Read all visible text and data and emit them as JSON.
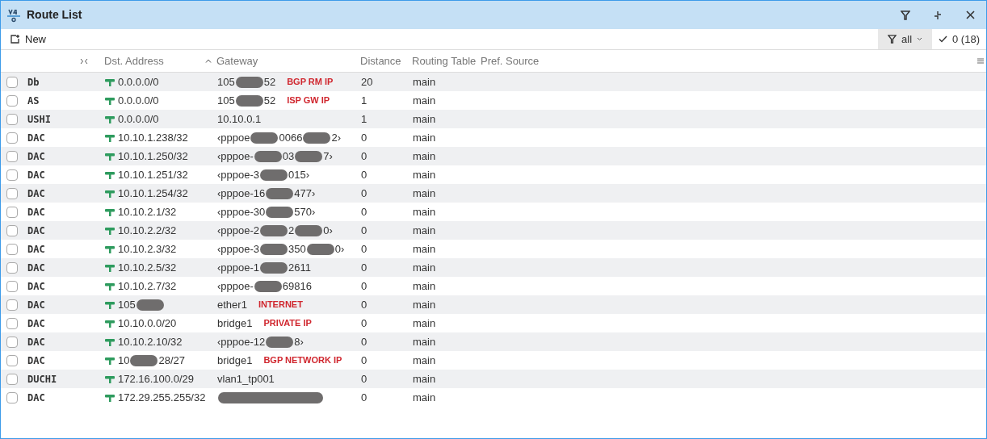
{
  "window": {
    "title": "Route List"
  },
  "toolbar": {
    "new_label": "New",
    "filter_value": "all",
    "selection_count": "0 (18)"
  },
  "columns": [
    {
      "label": "Dst. Address",
      "sorted": false
    },
    {
      "label": "Gateway",
      "sorted": true
    },
    {
      "label": "Distance",
      "sorted": false
    },
    {
      "label": "Routing Table",
      "sorted": false
    },
    {
      "label": "Pref. Source",
      "sorted": false
    }
  ],
  "rows": [
    {
      "checked": false,
      "flags": "Db",
      "dst": [
        "0.0.0.0/0"
      ],
      "gateway": [
        "105",
        "52"
      ],
      "note": "BGP RM IP",
      "distance": "20",
      "table": "main"
    },
    {
      "checked": false,
      "flags": "AS",
      "dst": [
        "0.0.0.0/0"
      ],
      "gateway": [
        "105",
        "52"
      ],
      "note": "ISP GW IP",
      "distance": "1",
      "table": "main"
    },
    {
      "checked": false,
      "flags": "USHI",
      "dst": [
        "0.0.0.0/0"
      ],
      "gateway": [
        "10.10.0.1"
      ],
      "distance": "1",
      "table": "main"
    },
    {
      "checked": false,
      "flags": "DAC",
      "dst": [
        "10.10.1.238/32"
      ],
      "gateway": [
        "‹pppoe",
        "0066",
        "2›"
      ],
      "distance": "0",
      "table": "main"
    },
    {
      "checked": false,
      "flags": "DAC",
      "dst": [
        "10.10.1.250/32"
      ],
      "gateway": [
        "‹pppoe-",
        "03",
        "7›"
      ],
      "distance": "0",
      "table": "main"
    },
    {
      "checked": false,
      "flags": "DAC",
      "dst": [
        "10.10.1.251/32"
      ],
      "gateway": [
        "‹pppoe-3",
        "015›"
      ],
      "distance": "0",
      "table": "main"
    },
    {
      "checked": false,
      "flags": "DAC",
      "dst": [
        "10.10.1.254/32"
      ],
      "gateway": [
        "‹pppoe-16",
        "477›"
      ],
      "distance": "0",
      "table": "main"
    },
    {
      "checked": false,
      "flags": "DAC",
      "dst": [
        "10.10.2.1/32"
      ],
      "gateway": [
        "‹pppoe-30",
        "570›"
      ],
      "distance": "0",
      "table": "main"
    },
    {
      "checked": false,
      "flags": "DAC",
      "dst": [
        "10.10.2.2/32"
      ],
      "gateway": [
        "‹pppoe-2",
        "2",
        "0›"
      ],
      "distance": "0",
      "table": "main"
    },
    {
      "checked": false,
      "flags": "DAC",
      "dst": [
        "10.10.2.3/32"
      ],
      "gateway": [
        "‹pppoe-3",
        "350",
        "0›"
      ],
      "distance": "0",
      "table": "main"
    },
    {
      "checked": false,
      "flags": "DAC",
      "dst": [
        "10.10.2.5/32"
      ],
      "gateway": [
        "‹pppoe-1",
        "2611"
      ],
      "distance": "0",
      "table": "main"
    },
    {
      "checked": false,
      "flags": "DAC",
      "dst": [
        "10.10.2.7/32"
      ],
      "gateway": [
        "‹pppoe-",
        "69816"
      ],
      "distance": "0",
      "table": "main"
    },
    {
      "checked": false,
      "flags": "DAC",
      "dst": [
        "105"
      ],
      "dst_redacted_tail": true,
      "gateway": [
        "ether1"
      ],
      "note": "INTERNET",
      "distance": "0",
      "table": "main"
    },
    {
      "checked": false,
      "flags": "DAC",
      "dst": [
        "10.10.0.0/20"
      ],
      "gateway": [
        "bridge1"
      ],
      "note": "PRIVATE IP",
      "distance": "0",
      "table": "main"
    },
    {
      "checked": false,
      "flags": "DAC",
      "dst": [
        "10.10.2.10/32"
      ],
      "gateway": [
        "‹pppoe-12",
        "8›"
      ],
      "distance": "0",
      "table": "main"
    },
    {
      "checked": false,
      "flags": "DAC",
      "dst": [
        "10",
        "28/27"
      ],
      "gateway": [
        "bridge1"
      ],
      "note": "BGP NETWORK IP",
      "distance": "0",
      "table": "main"
    },
    {
      "checked": false,
      "flags": "DUCHI",
      "dst": [
        "172.16.100.0/29"
      ],
      "gateway": [
        "vlan1_tp001"
      ],
      "distance": "0",
      "table": "main"
    },
    {
      "checked": false,
      "flags": "DAC",
      "dst": [
        "172.29.255.255/32"
      ],
      "gateway_redacted": true,
      "distance": "0",
      "table": "main"
    }
  ]
}
